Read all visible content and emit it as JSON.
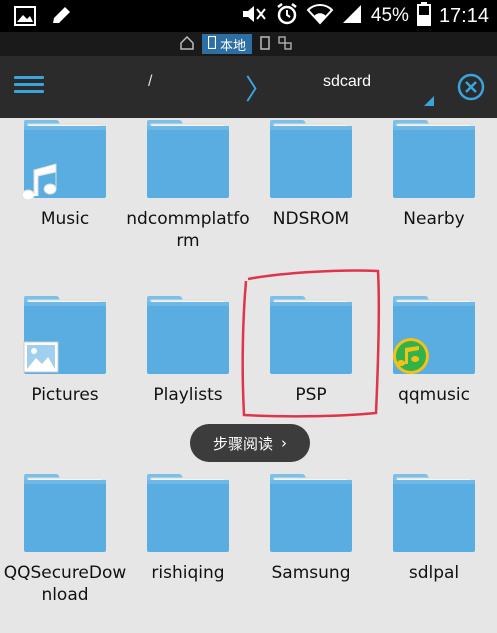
{
  "status_bar": {
    "battery_percent": "45%",
    "time": "17:14"
  },
  "location_bar": {
    "local_tab_label": "本地"
  },
  "action_bar": {
    "path_root": "/",
    "path_separator": "〉",
    "path_current": "sdcard"
  },
  "folders": [
    {
      "name": "Music",
      "badge": "music-note"
    },
    {
      "name": "ndcommplatform",
      "badge": ""
    },
    {
      "name": "NDSROM",
      "badge": ""
    },
    {
      "name": "Nearby",
      "badge": ""
    },
    {
      "name": "Pictures",
      "badge": "picture"
    },
    {
      "name": "Playlists",
      "badge": ""
    },
    {
      "name": "PSP",
      "badge": ""
    },
    {
      "name": "qqmusic",
      "badge": "qqmusic-logo"
    },
    {
      "name": "QQSecureDownload",
      "badge": ""
    },
    {
      "name": "rishiqing",
      "badge": ""
    },
    {
      "name": "Samsung",
      "badge": ""
    },
    {
      "name": "sdlpal",
      "badge": ""
    }
  ],
  "guide_pill": {
    "label": "步骤阅读",
    "arrow": "›"
  },
  "colors": {
    "folder_blue": "#5aade0",
    "folder_tab": "#7cc0e8",
    "accent": "#3aa4dd",
    "highlight": "#e0344a"
  }
}
